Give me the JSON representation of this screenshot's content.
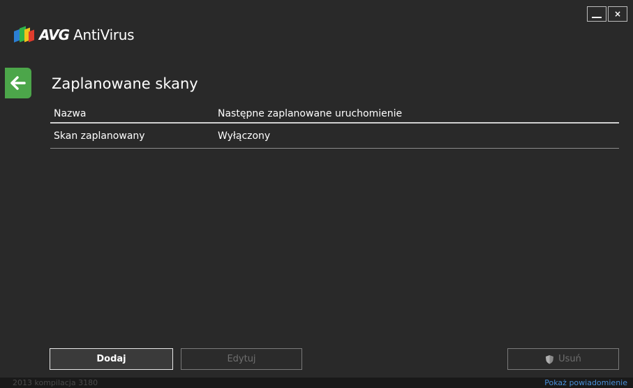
{
  "app": {
    "brand": "AVG",
    "product": "AntiVirus"
  },
  "window_controls": {
    "minimize": "",
    "close": "×"
  },
  "page": {
    "title": "Zaplanowane skany"
  },
  "table": {
    "columns": [
      "Nazwa",
      "Następne zaplanowane uruchomienie"
    ],
    "rows": [
      [
        "Skan zaplanowany",
        "Wyłączony"
      ]
    ]
  },
  "buttons": {
    "add": "Dodaj",
    "edit": "Edytuj",
    "delete": "Usuń"
  },
  "footer": {
    "version": "2013  kompilacja 3180",
    "notifications": "Pokaż powiadomienie"
  },
  "colors": {
    "background": "#292929",
    "back_button": "#4ca64a",
    "link": "#4a8fd8"
  }
}
